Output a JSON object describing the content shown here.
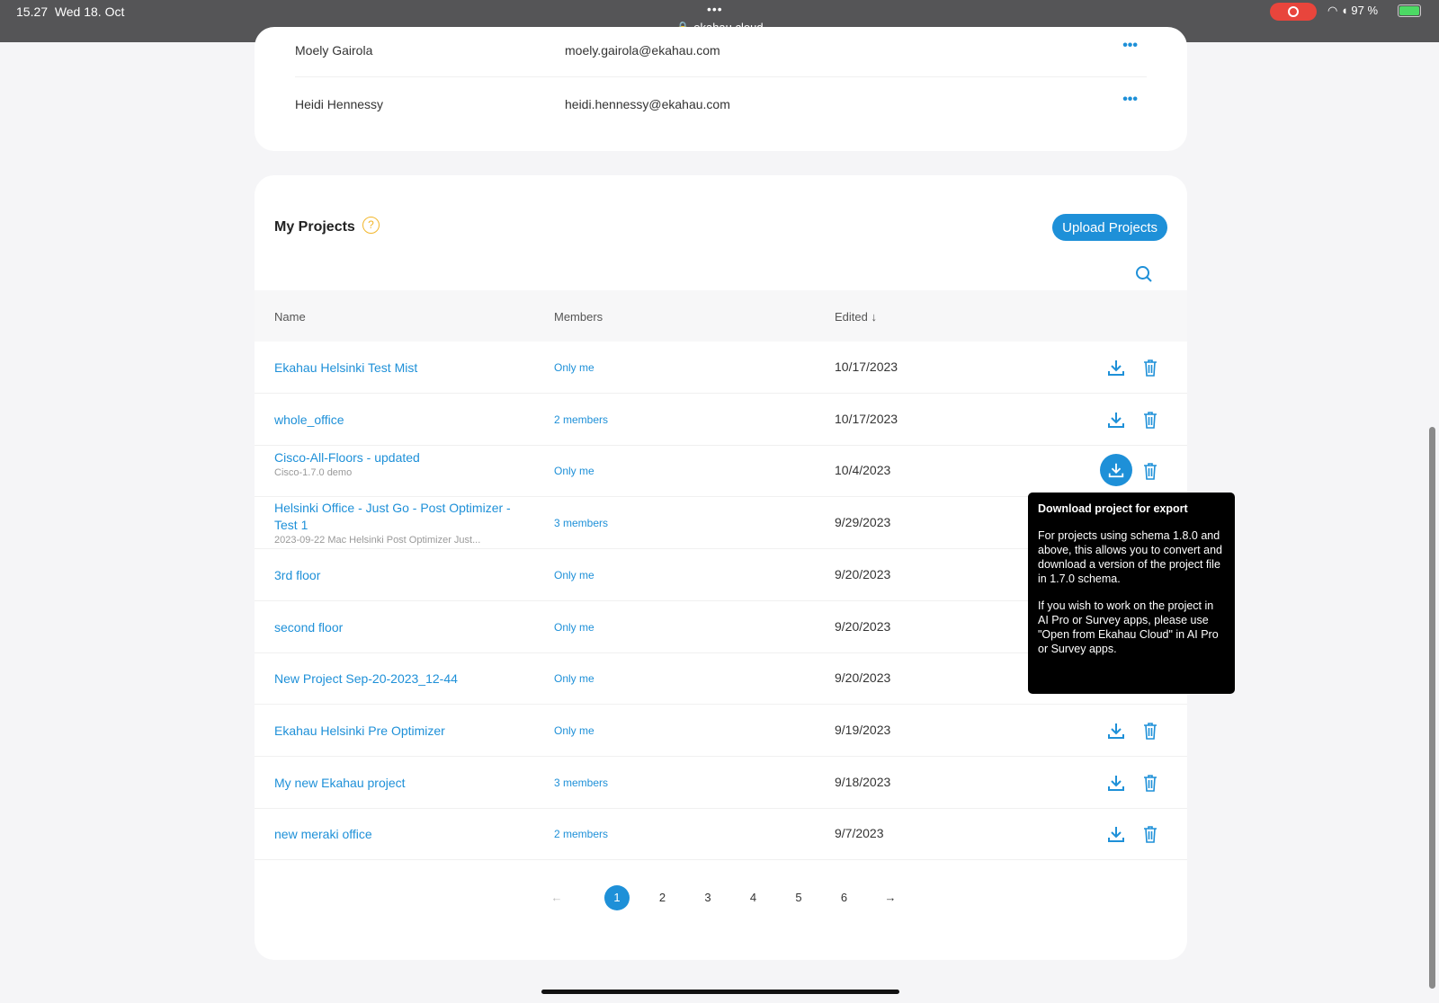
{
  "status_bar": {
    "time": "15.27  Wed 18. Oct",
    "url": "ekahau.cloud",
    "battery": "97 %",
    "more": "•••"
  },
  "members": [
    {
      "name": "Moely Gairola",
      "email": "moely.gairola@ekahau.com"
    },
    {
      "name": "Heidi Hennessy",
      "email": "heidi.hennessy@ekahau.com"
    }
  ],
  "projects": {
    "title": "My Projects",
    "help": "?",
    "upload_label": "Upload Projects",
    "columns": {
      "name": "Name",
      "members": "Members",
      "edited": "Edited ↓"
    },
    "rows": [
      {
        "name": "Ekahau Helsinki Test Mist",
        "sub": "",
        "members": "Only me",
        "edited": "10/17/2023"
      },
      {
        "name": "whole_office",
        "sub": "",
        "members": "2 members",
        "edited": "10/17/2023"
      },
      {
        "name": "Cisco-All-Floors - updated",
        "sub": "Cisco-1.7.0 demo",
        "members": "Only me",
        "edited": "10/4/2023"
      },
      {
        "name": "Helsinki Office - Just Go - Post Optimizer - Test 1",
        "sub": "2023-09-22 Mac Helsinki Post Optimizer Just...",
        "members": "3 members",
        "edited": "9/29/2023"
      },
      {
        "name": "3rd floor",
        "sub": "",
        "members": "Only me",
        "edited": "9/20/2023"
      },
      {
        "name": "second floor",
        "sub": "",
        "members": "Only me",
        "edited": "9/20/2023"
      },
      {
        "name": "New Project Sep-20-2023_12-44",
        "sub": "",
        "members": "Only me",
        "edited": "9/20/2023"
      },
      {
        "name": "Ekahau Helsinki Pre Optimizer",
        "sub": "",
        "members": "Only me",
        "edited": "9/19/2023"
      },
      {
        "name": "My new Ekahau project",
        "sub": "",
        "members": "3 members",
        "edited": "9/18/2023"
      },
      {
        "name": "new meraki office",
        "sub": "",
        "members": "2 members",
        "edited": "9/7/2023"
      }
    ],
    "pagination": {
      "prev": "←",
      "pages": [
        "1",
        "2",
        "3",
        "4",
        "5",
        "6"
      ],
      "current": "1",
      "next": "→"
    }
  },
  "tooltip": {
    "title": "Download project for export",
    "p1": "For projects using schema 1.8.0 and above, this allows you to convert and download a version of the project file in 1.7.0 schema.",
    "p2": "If you wish to work on the project in AI Pro or Survey apps, please use \"Open from Ekahau Cloud\" in AI Pro or Survey apps."
  },
  "colors": {
    "accent": "#1e90d8",
    "help": "#f2b62a"
  }
}
